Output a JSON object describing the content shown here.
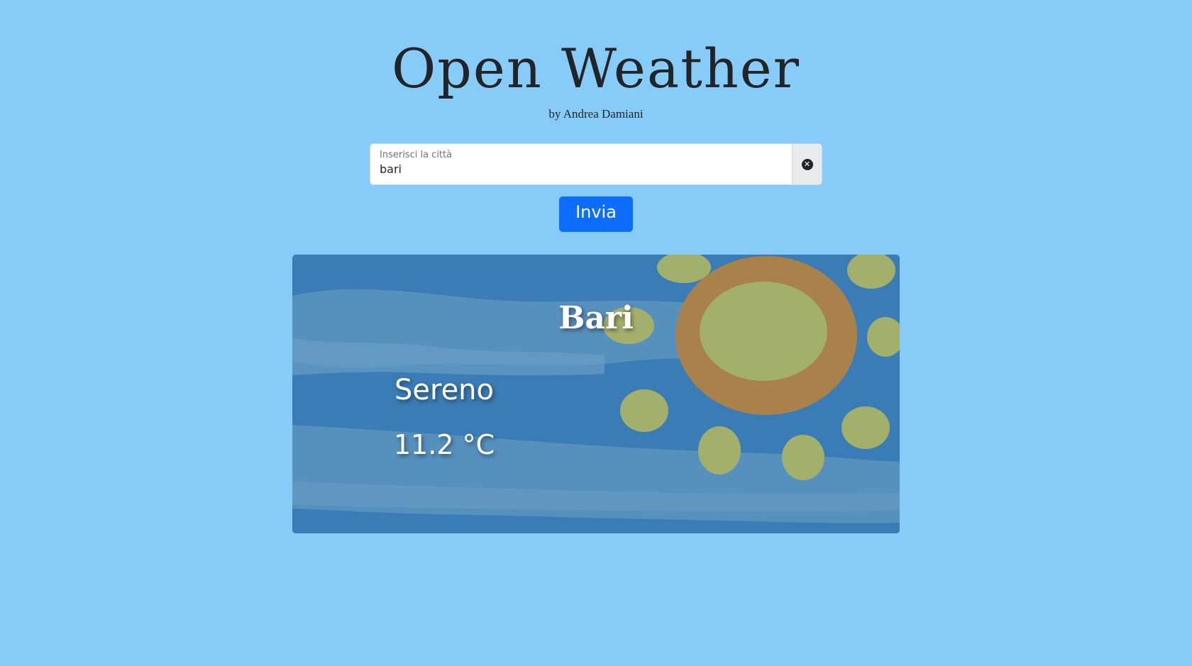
{
  "header": {
    "title": "Open Weather",
    "byline": "by Andrea Damiani"
  },
  "search": {
    "label": "Inserisci la città",
    "value": "bari",
    "clear_icon": "close-circle-icon"
  },
  "submit": {
    "label": "Invia"
  },
  "weather": {
    "city": "Bari",
    "condition": "Sereno",
    "temperature": "11.2 °C",
    "illustration": "sun-painting",
    "colors": {
      "sky": "#3a7cb5",
      "cloud_band": "#5a92be",
      "sun_ring": "#a8824a",
      "sun_core": "#a3b06b"
    }
  },
  "colors": {
    "page_background": "#87ccf8",
    "primary_button": "#0d6efd",
    "text_dark": "#212529"
  }
}
